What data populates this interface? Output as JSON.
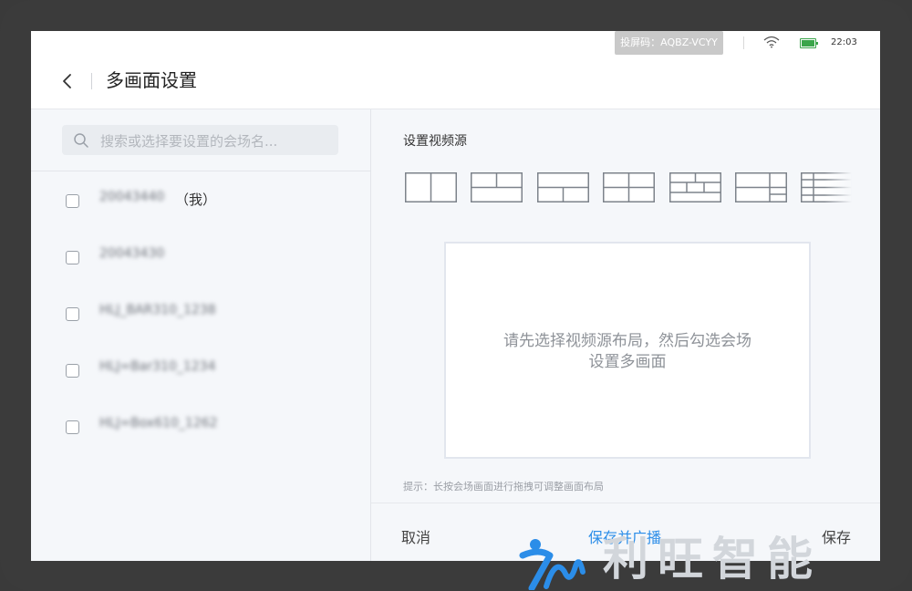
{
  "status_bar": {
    "cast_code": "投屏码：AQBZ-VCYY",
    "time": "22:03",
    "battery_color": "#3aa54a"
  },
  "header": {
    "back_icon": "chevron-left-icon",
    "title": "多画面设置"
  },
  "sidebar": {
    "search_placeholder": "搜索或选择要设置的会场名...",
    "items": [
      {
        "name": "20043440",
        "suffix": "（我）"
      },
      {
        "name": "20043430",
        "suffix": ""
      },
      {
        "name": "HLJ_BAR310_1238",
        "suffix": ""
      },
      {
        "name": "HLJ=Bar310_1234",
        "suffix": ""
      },
      {
        "name": "HLJ=Box610_1262",
        "suffix": ""
      }
    ]
  },
  "main": {
    "section_title": "设置视频源",
    "layout_options": [
      "split-2",
      "split-3-top",
      "split-3-bottom",
      "split-4",
      "split-6",
      "split-5",
      "split-more"
    ],
    "preview_message_line1": "请先选择视频源布局，然后勾选会场",
    "preview_message_line2": "设置多画面",
    "tip": "提示：长按会场画面进行拖拽可调整画面布局"
  },
  "actions": {
    "cancel_label": "取消",
    "save_broadcast_label": "保存并广播",
    "save_label": "保存"
  },
  "watermark": {
    "text": "利旺智能",
    "logo_color": "#2b8de8"
  },
  "colors": {
    "accent": "#2b8de8",
    "background": "#f5f7fa"
  }
}
